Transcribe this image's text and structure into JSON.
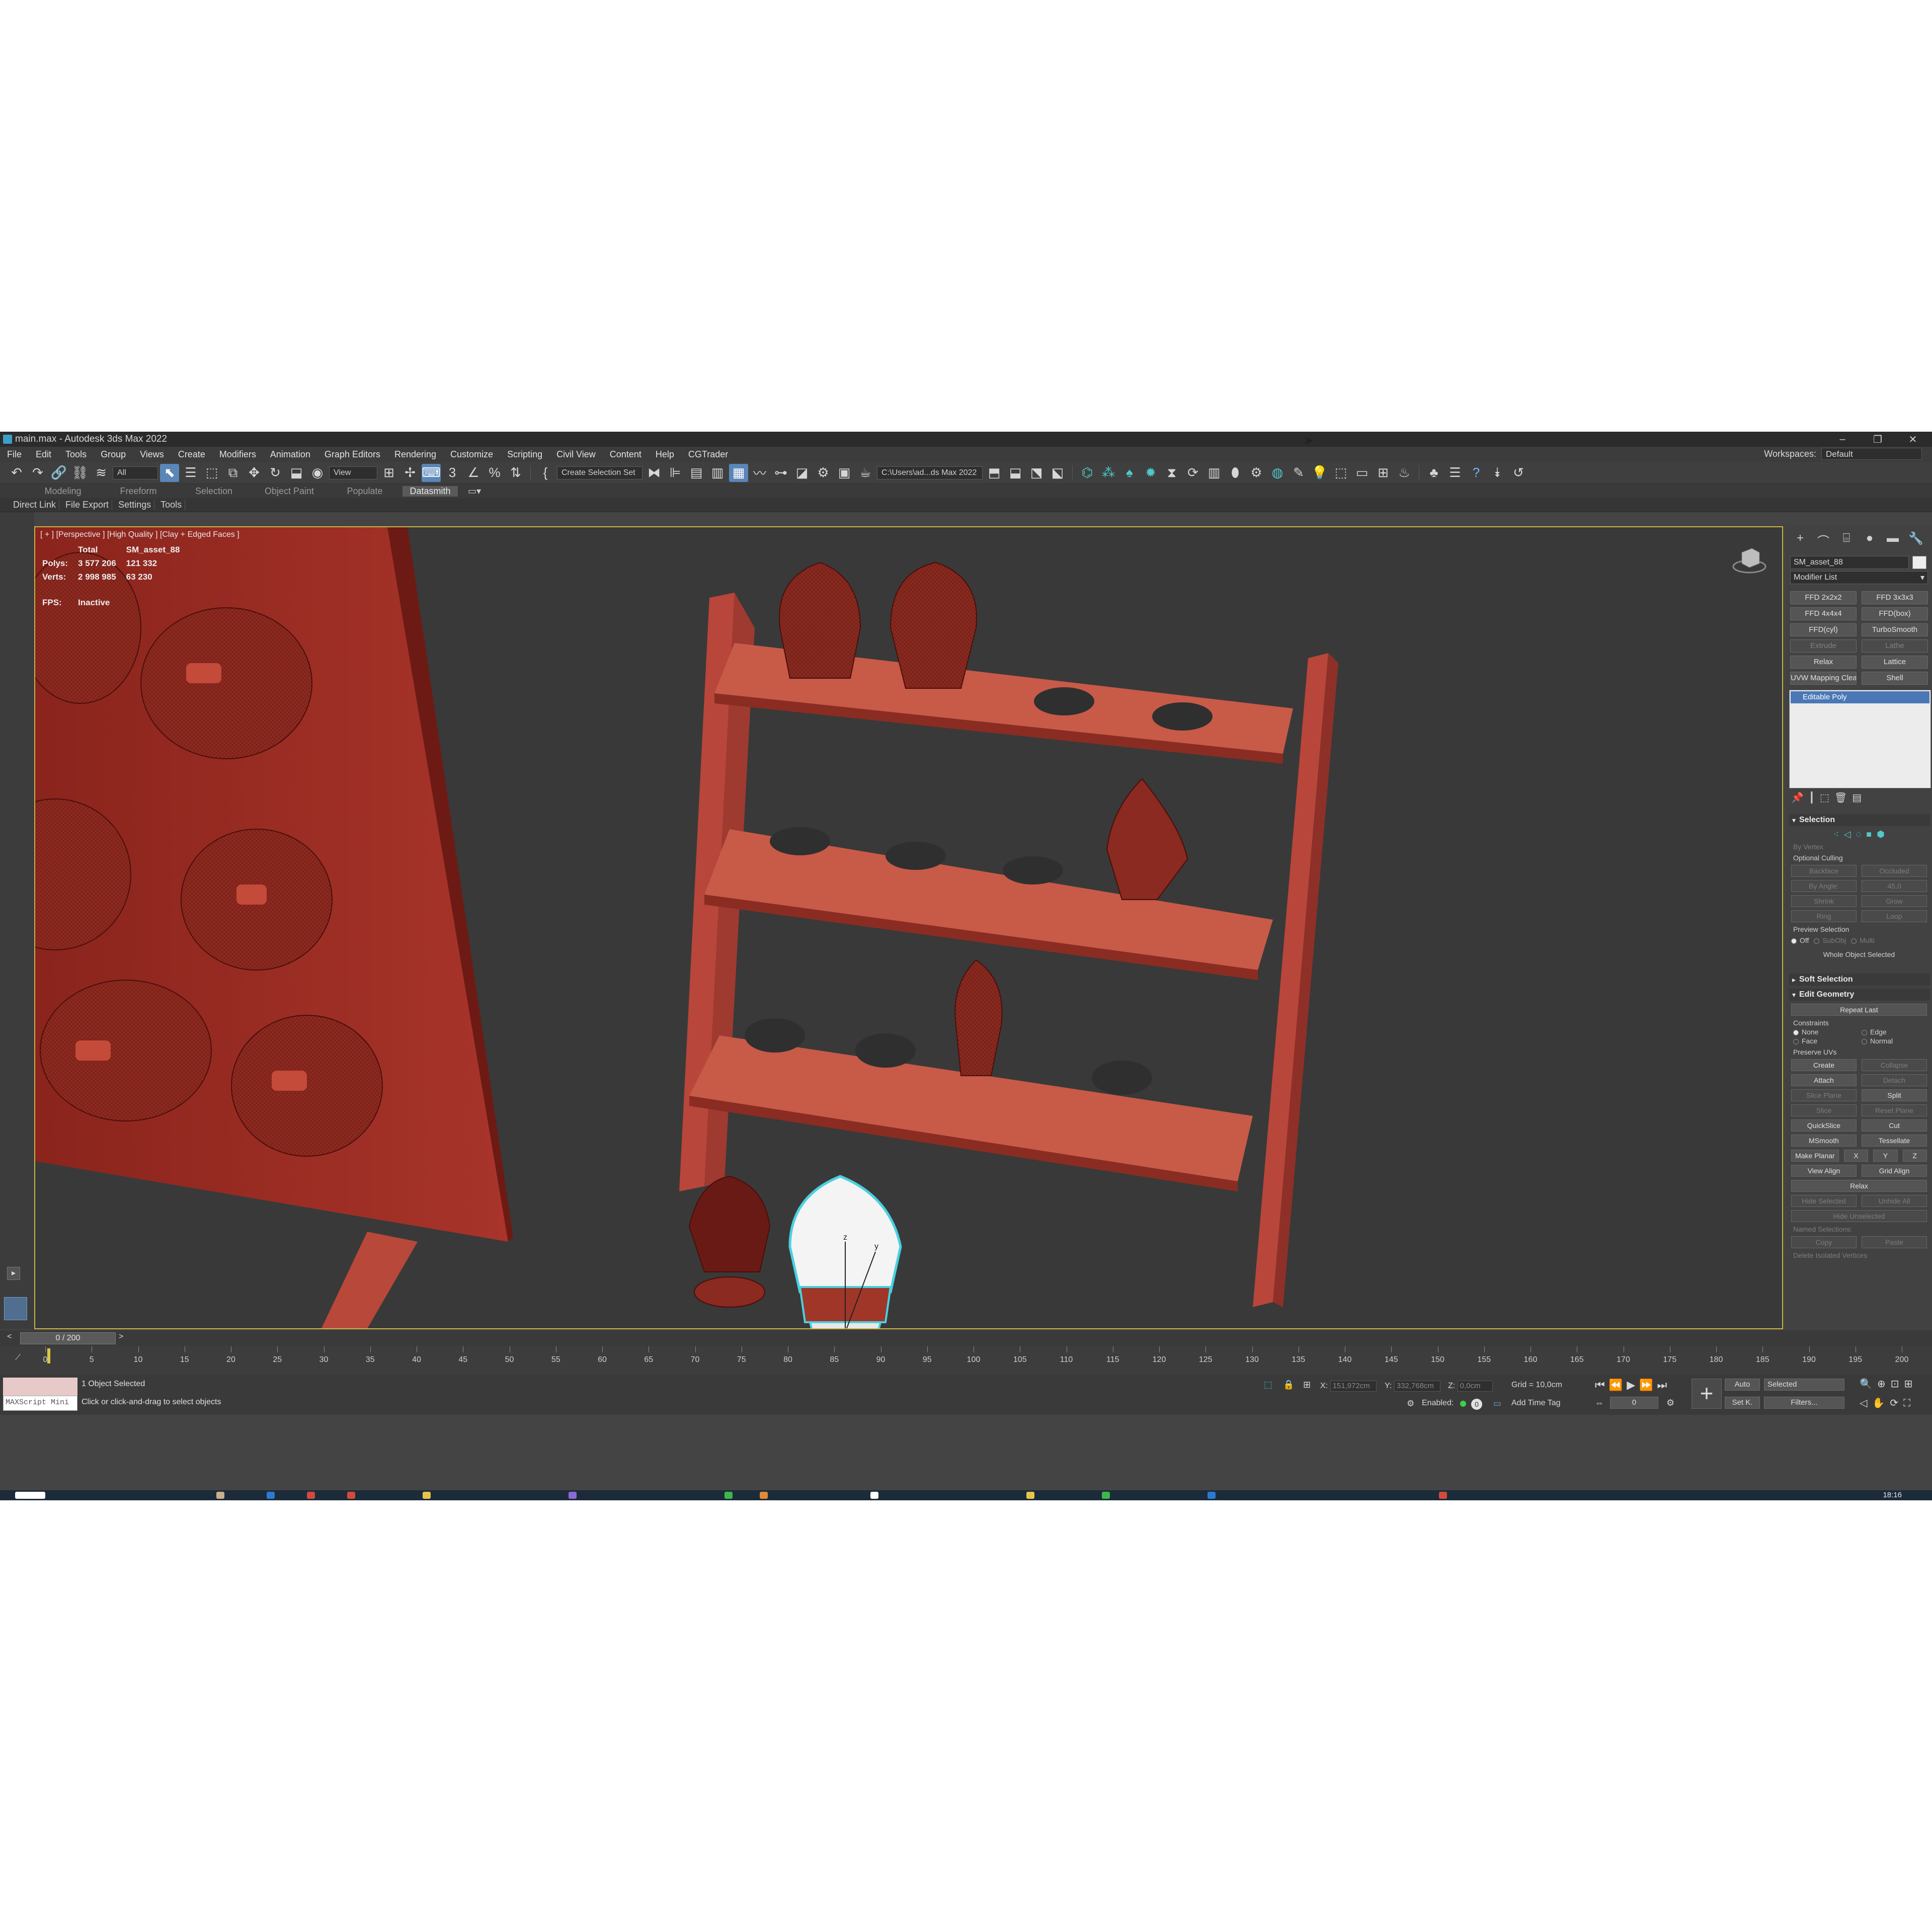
{
  "window": {
    "title": "main.max - Autodesk 3ds Max 2022",
    "minimize": "–",
    "restore": "❐",
    "close": "✕"
  },
  "menu": {
    "items": [
      "File",
      "Edit",
      "Tools",
      "Group",
      "Views",
      "Create",
      "Modifiers",
      "Animation",
      "Graph Editors",
      "Rendering",
      "Customize",
      "Scripting",
      "Civil View",
      "Content",
      "Help",
      "CGTrader"
    ],
    "workspaces_label": "Workspaces:",
    "workspace_value": "Default"
  },
  "toolbar": {
    "filter_value": "All",
    "ref_coord_value": "View",
    "selection_set": "Create Selection Set",
    "project_path": "C:\\Users\\ad...ds Max 2022"
  },
  "ribbon": {
    "tabs": [
      "Modeling",
      "Freeform",
      "Selection",
      "Object Paint",
      "Populate",
      "Datasmith"
    ],
    "active": "Datasmith",
    "subtabs": [
      "Direct Link",
      "File Export",
      "Settings",
      "Tools"
    ]
  },
  "viewport": {
    "label": "[ + ] [Perspective ] [High Quality ] [Clay + Edged Faces ]",
    "stats": {
      "col_total": "Total",
      "col_object": "SM_asset_88",
      "polys_label": "Polys:",
      "polys_total": "3 577 206",
      "polys_object": "121 332",
      "verts_label": "Verts:",
      "verts_total": "2 998 985",
      "verts_object": "63 230",
      "fps_label": "FPS:",
      "fps_value": "Inactive"
    },
    "gizmo_x": "x",
    "gizmo_y": "y",
    "gizmo_z": "z"
  },
  "command_panel": {
    "object_name": "SM_asset_88",
    "modifier_list": "Modifier List",
    "modifiers": [
      "FFD 2x2x2",
      "FFD 3x3x3",
      "FFD 4x4x4",
      "FFD(box)",
      "FFD(cyl)",
      "TurboSmooth",
      "Extrude",
      "Lathe",
      "Relax",
      "Lattice",
      "UVW Mapping Clea",
      "Shell"
    ],
    "stack_item": "Editable Poly",
    "selection": {
      "title": "Selection",
      "by_vertex": "By Vertex",
      "optional_culling": "Optional Culling",
      "backface": "Backface",
      "occluded": "Occluded",
      "by_angle": "By Angle:",
      "angle_value": "45,0",
      "shrink": "Shrink",
      "grow": "Grow",
      "ring": "Ring",
      "loop": "Loop",
      "preview_selection": "Preview Selection",
      "off": "Off",
      "subobj": "SubObj",
      "multi": "Multi",
      "status": "Whole Object Selected"
    },
    "soft_selection": "Soft Selection",
    "edit_geometry": {
      "title": "Edit Geometry",
      "repeat_last": "Repeat Last",
      "constraints": "Constraints",
      "none": "None",
      "edge": "Edge",
      "face": "Face",
      "normal": "Normal",
      "preserve_uvs": "Preserve UVs",
      "create": "Create",
      "collapse": "Collapse",
      "attach": "Attach",
      "detach": "Detach",
      "slice_plane": "Slice Plane",
      "split": "Split",
      "slice": "Slice",
      "reset_plane": "Reset Plane",
      "quickslice": "QuickSlice",
      "cut": "Cut",
      "msmooth": "MSmooth",
      "tessellate": "Tessellate",
      "make_planar": "Make Planar",
      "x": "X",
      "y": "Y",
      "z": "Z",
      "view_align": "View Align",
      "grid_align": "Grid Align",
      "relax": "Relax",
      "hide_selected": "Hide Selected",
      "unhide_all": "Unhide All",
      "hide_unselected": "Hide Unselected",
      "named_selections": "Named Selections:",
      "copy": "Copy",
      "paste": "Paste",
      "delete_isolated": "Delete Isolated Vertices"
    }
  },
  "timeline": {
    "slider_value": "0 / 200",
    "ticks": [
      "0",
      "5",
      "10",
      "15",
      "20",
      "25",
      "30",
      "35",
      "40",
      "45",
      "50",
      "55",
      "60",
      "65",
      "70",
      "75",
      "80",
      "85",
      "90",
      "95",
      "100",
      "105",
      "110",
      "115",
      "120",
      "125",
      "130",
      "135",
      "140",
      "145",
      "150",
      "155",
      "160",
      "165",
      "170",
      "175",
      "180",
      "185",
      "190",
      "195",
      "200"
    ]
  },
  "status": {
    "maxscript": "MAXScript Mini",
    "selected": "1 Object Selected",
    "prompt": "Click or click-and-drag to select objects",
    "x_label": "X:",
    "x_value": "151,972cm",
    "y_label": "Y:",
    "y_value": "332,768cm",
    "z_label": "Z:",
    "z_value": "0,0cm",
    "grid": "Grid = 10,0cm",
    "enabled": "Enabled:",
    "add_time_tag": "Add Time Tag",
    "auto": "Auto",
    "selected_dd": "Selected",
    "setk": "Set K.",
    "filters": "Filters...",
    "frame": "0",
    "clock": "18:16"
  }
}
